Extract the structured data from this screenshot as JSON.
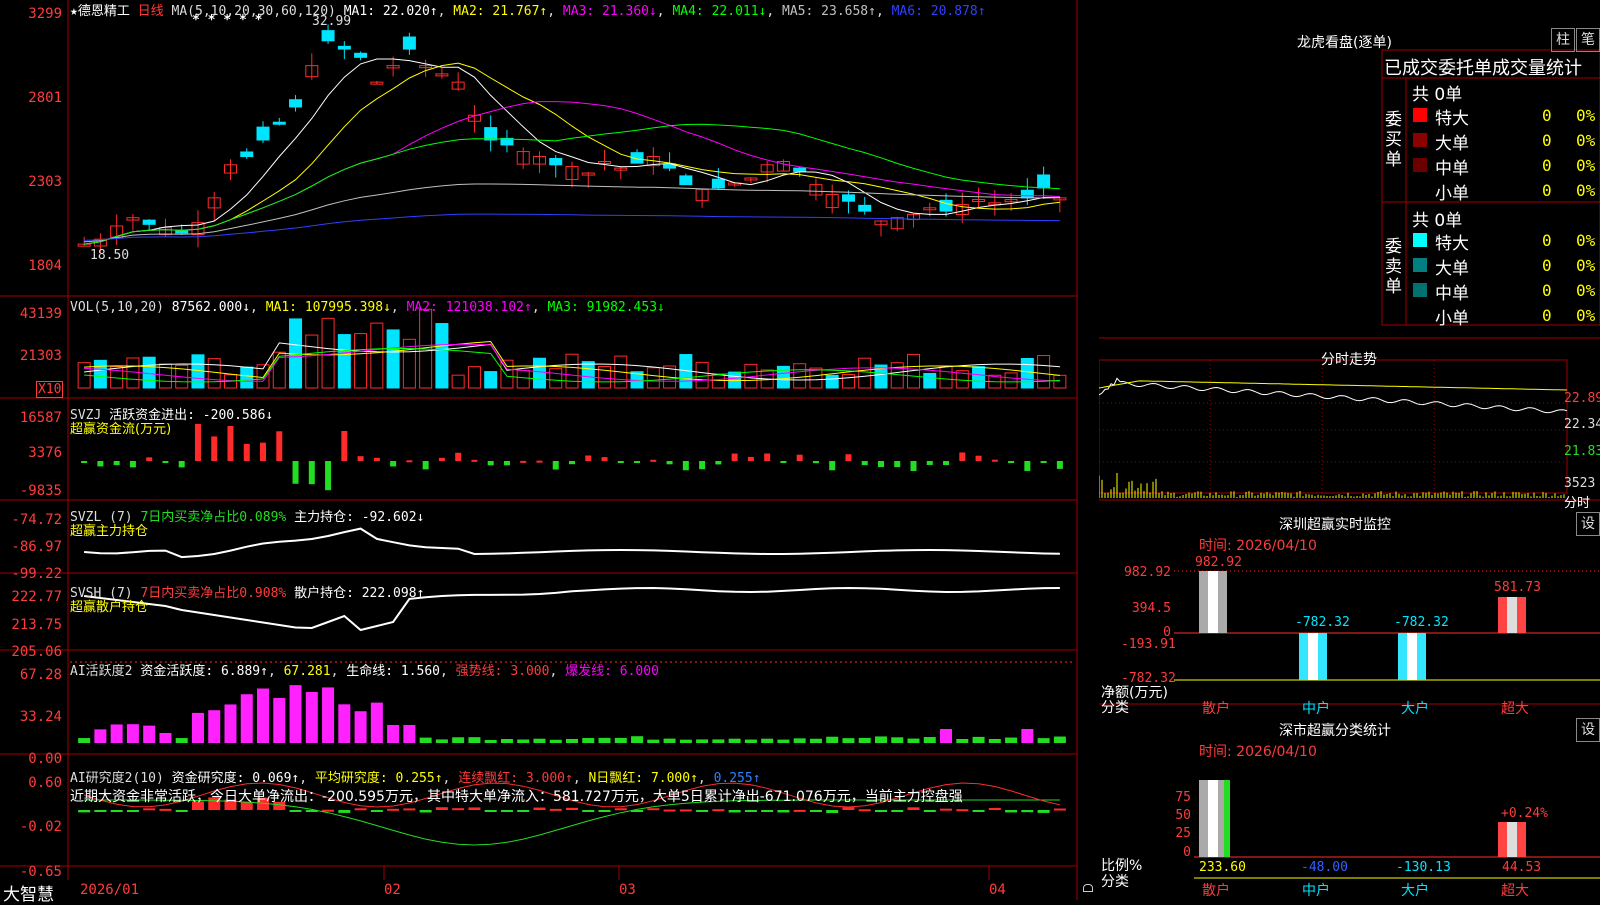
{
  "colors": {
    "up": "#ff2b2b",
    "down": "#00e5ff",
    "grid": "#a00000",
    "ma1": "#ffffff",
    "ma2": "#ffff00",
    "ma3": "#ff00ff",
    "ma4": "#00ff00",
    "ma5": "#c0c0c0",
    "ma6": "#3040ff",
    "green": "#22dd22",
    "magenta": "#ff22ff"
  },
  "main": {
    "star": "★",
    "stock_name": "德恩精工",
    "period": "日线",
    "ma_label": "MA(5,10,20,30,60,120)",
    "ma1": "MA1: 22.020↑",
    "ma2": "MA2: 21.767↑",
    "ma3": "MA3: 21.360↓",
    "ma4": "MA4: 22.011↓",
    "ma5": "MA5: 23.658↑",
    "ma6": "MA6: 20.878↑",
    "stars": "* * * * *",
    "high_label": "32.99",
    "low_label": "18.50",
    "axis": [
      "3299",
      "2801",
      "2303",
      "1804"
    ]
  },
  "vol": {
    "label": "VOL(5,10,20)",
    "value": "87562.000↓",
    "ma1": "MA1: 107995.398↓",
    "ma2": "MA2: 121038.102↑",
    "ma3": "MA3: 91982.453↓",
    "axis": [
      "43139",
      "21303"
    ],
    "unit": "X10"
  },
  "svzj": {
    "label": "SVZJ",
    "desc": "活跃资金进出: -200.586↓",
    "title": "超赢资金流(万元)",
    "axis": [
      "16587",
      "3376",
      "-9835"
    ]
  },
  "svzl": {
    "label": "SVZL (7)",
    "desc1": "7日内买卖净占比0.089%",
    "desc2": "主力持仓: -92.602↓",
    "title": "超赢主力持仓",
    "axis": [
      "-74.72",
      "-86.97",
      "-99.22"
    ]
  },
  "svsh": {
    "label": "SVSH (7)",
    "desc1": "7日内买卖净占比0.908%",
    "desc2": "散户持仓: 222.098↑",
    "title": "超赢散户持仓",
    "axis": [
      "222.77",
      "213.75",
      "205.06"
    ]
  },
  "ai1": {
    "label": "AI活跃度2",
    "a": "资金活跃度: 6.889↑",
    "b": "67.281",
    "c": "生命线: 1.560",
    "d": "强势线: 3.000",
    "e": "爆发线: 6.000",
    "axis": [
      "67.28",
      "33.24",
      "0.00"
    ]
  },
  "ai2": {
    "label": "AI研究度2(10)",
    "a": "资金研究度: 0.069↑",
    "b": "平均研究度: 0.255↑",
    "c": "连续飘红: 3.000↑",
    "d": "N日飘红: 7.000↑",
    "e": "0.255↑",
    "summary": "近期大资金非常活跃，今日大单净流出：-200.595万元，其中特大单净流入：581.727万元，大单5日累计净出-671.076万元，当前主力控盘强",
    "axis": [
      "0.60",
      "-0.02",
      "-0.65"
    ]
  },
  "xaxis": {
    "labels": [
      "2026/01",
      "02",
      "03",
      "04"
    ]
  },
  "brand": "大智慧",
  "dragon": {
    "title": "龙虎看盘(逐单)",
    "tab1": "柱",
    "tab2": "笔",
    "header": "已成交委托单成交量统计",
    "buy_label": "委买单",
    "sell_label": "委卖单",
    "buy_total": "共 0单",
    "sell_total": "共 0单",
    "rows_buy": [
      {
        "name": "特大",
        "count": "0",
        "pct": "0%"
      },
      {
        "name": "大单",
        "count": "0",
        "pct": "0%"
      },
      {
        "name": "中单",
        "count": "0",
        "pct": "0%"
      },
      {
        "name": "小单",
        "count": "0",
        "pct": "0%"
      }
    ],
    "rows_sell": [
      {
        "name": "特大",
        "count": "0",
        "pct": "0%"
      },
      {
        "name": "大单",
        "count": "0",
        "pct": "0%"
      },
      {
        "name": "中单",
        "count": "0",
        "pct": "0%"
      },
      {
        "name": "小单",
        "count": "0",
        "pct": "0%"
      }
    ]
  },
  "fenshi": {
    "title": "分时走势",
    "axis": [
      "22.89",
      "22.34",
      "21.83"
    ],
    "vol": "3523",
    "unit": "分时"
  },
  "monitor": {
    "title": "深圳超赢实时监控",
    "gear": "设",
    "time": "时间: 2026/04/10",
    "axis": [
      "982.92",
      "394.5",
      "0",
      "-193.91",
      "-782.32"
    ],
    "ylabel1": "净额(万元)",
    "ylabel2": "分类",
    "values": [
      "982.92",
      "-782.32",
      "-782.32",
      "581.73"
    ],
    "cats": [
      "散户",
      "中户",
      "大户",
      "超大"
    ]
  },
  "classify": {
    "title": "深市超赢分类统计",
    "gear": "设",
    "time": "时间: 2026/04/10",
    "axis": [
      "75",
      "50",
      "25",
      "0"
    ],
    "ylabel1": "比例%",
    "ylabel2": "分类",
    "top_label": "+0.24%",
    "values": [
      "233.60",
      "-48.00",
      "-130.13",
      "44.53"
    ],
    "cats": [
      "散户",
      "中户",
      "大户",
      "超大"
    ]
  }
}
